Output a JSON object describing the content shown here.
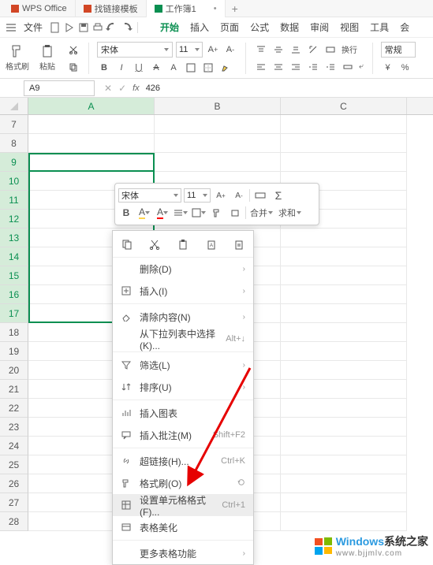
{
  "titlebar": {
    "apptab": "WPS Office",
    "doc1": "找链接模板",
    "doc2": "工作簿1"
  },
  "menubar": {
    "file": "文件",
    "start": "开始",
    "insert": "插入",
    "page": "页面",
    "formula": "公式",
    "data": "数据",
    "review": "审阅",
    "view": "视图",
    "tools": "工具",
    "member": "会"
  },
  "ribbon": {
    "fmt_painter": "格式刷",
    "paste": "粘贴",
    "font": "宋体",
    "size": "11",
    "wrap": "换行",
    "normal": "常规"
  },
  "fbar": {
    "name": "A9",
    "fx": "fx",
    "value": "426"
  },
  "grid": {
    "col_a": "A",
    "col_b": "B",
    "col_c": "C",
    "rows": [
      "7",
      "8",
      "9",
      "10",
      "11",
      "12",
      "13",
      "14",
      "15",
      "16",
      "17",
      "18",
      "19",
      "20",
      "21",
      "22",
      "23",
      "24",
      "25",
      "26",
      "27",
      "28"
    ],
    "a9": "426"
  },
  "mini": {
    "font": "宋体",
    "size": "11",
    "merge": "合并",
    "sum": "求和"
  },
  "ctx": {
    "delete": "删除(D)",
    "insert": "插入(I)",
    "clear": "清除内容(N)",
    "droplist": "从下拉列表中选择(K)...",
    "droplist_sc": "Alt+↓",
    "filter": "筛选(L)",
    "sort": "排序(U)",
    "chart": "插入图表",
    "comment": "插入批注(M)",
    "comment_sc": "Shift+F2",
    "hyperlink": "超链接(H)...",
    "hyperlink_sc": "Ctrl+K",
    "painter": "格式刷(O)",
    "cellfmt": "设置单元格格式(F)...",
    "cellfmt_sc": "Ctrl+1",
    "beautify": "表格美化",
    "more": "更多表格功能"
  },
  "wm": {
    "brand1": "Windows",
    "brand2": "系统之家",
    "url": "www.bjjmlv.com"
  },
  "chart_data": null
}
